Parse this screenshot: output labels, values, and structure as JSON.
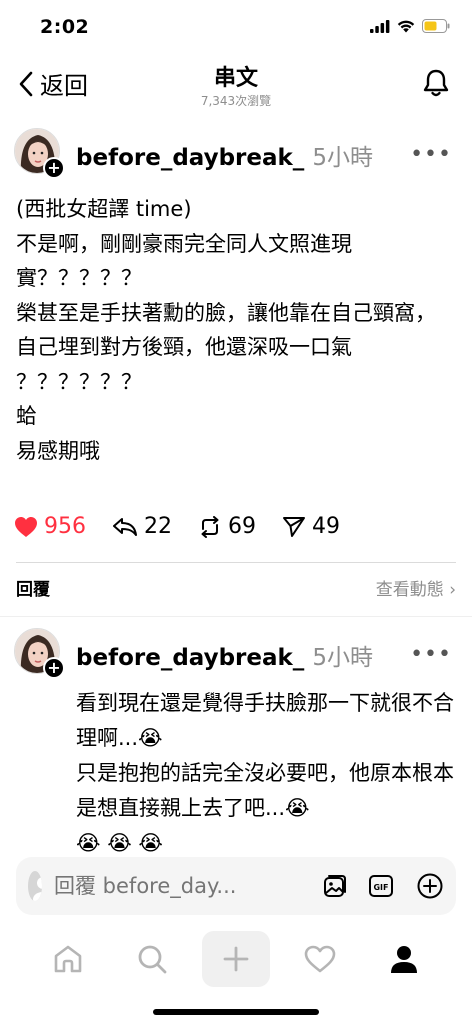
{
  "status": {
    "time": "2:02"
  },
  "nav": {
    "back_label": "返回",
    "title": "串文",
    "subtitle": "7,343次瀏覽"
  },
  "post": {
    "username": "before_daybreak_",
    "time_ago": "5小時",
    "body": "(西批女超譯 time)\n不是啊，剛剛豪雨完全同人文照進現實？？？？？\n榮甚至是手扶著勳的臉，讓他靠在自己頸窩，自己埋到對方後頸，他還深吸一口氣\n？？？？？？\n蛤\n易感期哦",
    "likes": "956",
    "comments": "22",
    "reposts": "69",
    "shares": "49"
  },
  "replies_header": {
    "label": "回覆",
    "view_activity": "查看動態 ›"
  },
  "comment": {
    "username": "before_daybreak_",
    "time_ago": "5小時",
    "body": "看到現在還是覺得手扶臉那一下就很不合理啊...😭\n只是抱抱的話完全沒必要吧，他原本根本是想直接親上去了吧...😭\n😭 😭 😭"
  },
  "composer": {
    "placeholder": "回覆 before_day..."
  },
  "tabs": [
    "home-icon",
    "search-icon",
    "create-icon",
    "activity-icon",
    "profile-icon"
  ],
  "colors": {
    "like": "#ff3040",
    "muted": "#8e8e8e",
    "battery": "#f5c518"
  }
}
